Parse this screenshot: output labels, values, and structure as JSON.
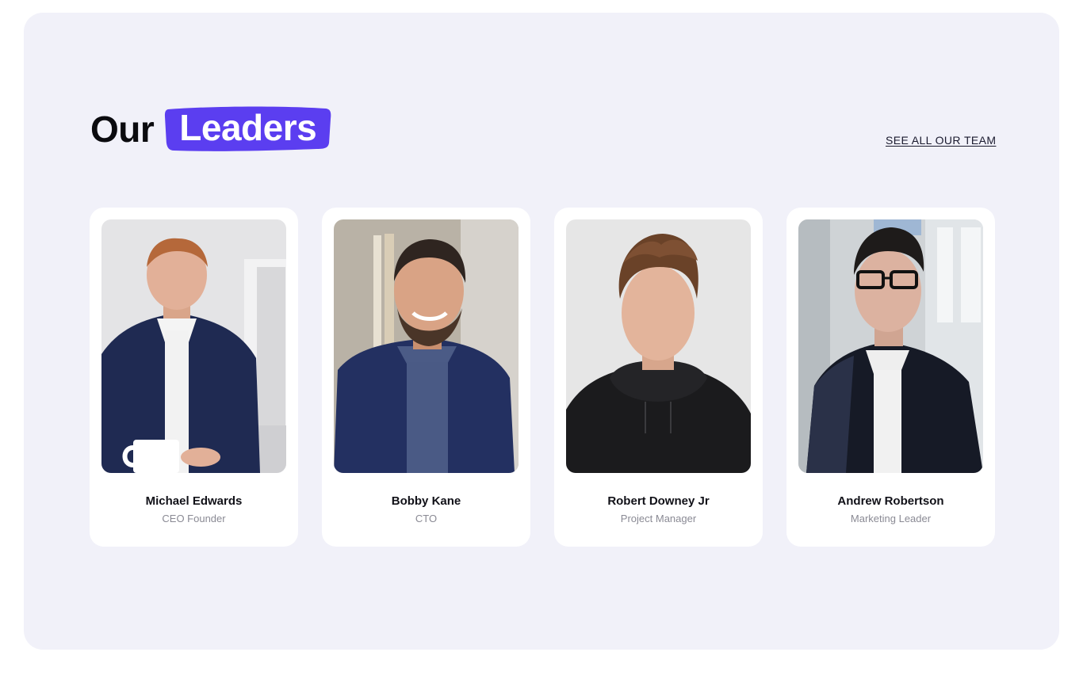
{
  "section": {
    "title_prefix": "Our",
    "title_highlight": "Leaders",
    "see_all_link": "SEE ALL OUR TEAM"
  },
  "colors": {
    "panel_background": "#f1f1f9",
    "highlight": "#5b3ef0",
    "card_background": "#ffffff"
  },
  "leaders": [
    {
      "name": "Michael Edwards",
      "role": "CEO Founder"
    },
    {
      "name": "Bobby Kane",
      "role": "CTO"
    },
    {
      "name": "Robert Downey Jr",
      "role": "Project Manager"
    },
    {
      "name": "Andrew Robertson",
      "role": "Marketing Leader"
    }
  ]
}
